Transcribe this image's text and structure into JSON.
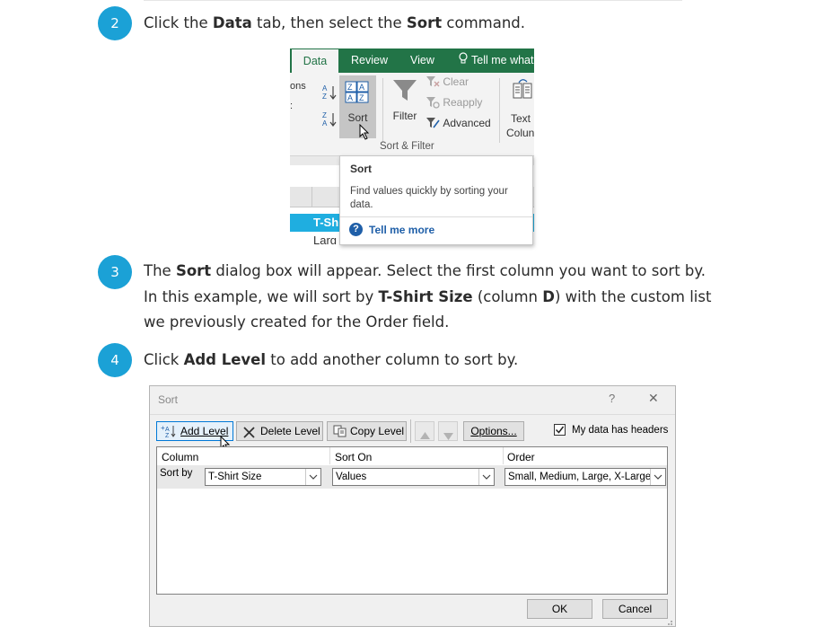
{
  "steps": [
    {
      "number": "2",
      "parts": [
        "Click the ",
        "Data",
        " tab, then select the ",
        "Sort",
        " command."
      ]
    },
    {
      "number": "3",
      "lines": [
        [
          "The ",
          "Sort",
          " dialog box will appear. Select the first column you want to sort by."
        ],
        [
          "In this example, we will sort by ",
          "T-Shirt Size",
          " (column ",
          "D",
          ") with the custom list"
        ],
        [
          "we previously created for the Order field."
        ]
      ]
    },
    {
      "number": "4",
      "parts": [
        "Click ",
        "Add Level",
        " to add another column to sort by."
      ]
    }
  ],
  "ribbon": {
    "tabs": [
      "Data",
      "Review",
      "View",
      "Tell me what"
    ],
    "partial_left_label": "ons",
    "sort_label": "Sort",
    "filter_label": "Filter",
    "clear_label": "Clear",
    "reapply_label": "Reapply",
    "advanced_label": "Advanced",
    "text_label": "Text",
    "column_label_partial": "Colun",
    "group_label": "Sort & Filter",
    "cell_header_partial": "T-Sh",
    "cell_row_partial": "Larg"
  },
  "tooltip": {
    "title": "Sort",
    "description": "Find values quickly by sorting your data.",
    "tell_me_more": "Tell me more"
  },
  "dialog": {
    "title": "Sort",
    "help_icon": "?",
    "close_icon": "✕",
    "add_level": "Add Level",
    "delete_level": "Delete Level",
    "copy_level": "Copy Level",
    "options": "Options...",
    "headers_checkbox_label": "My data has headers",
    "headers_checked": true,
    "columns": {
      "column": "Column",
      "sort_on": "Sort On",
      "order": "Order"
    },
    "row": {
      "label": "Sort by",
      "column_value": "T-Shirt Size",
      "sort_on_value": "Values",
      "order_value": "Small, Medium, Large, X-Large"
    },
    "ok": "OK",
    "cancel": "Cancel"
  },
  "colors": {
    "badge": "#1ba1d6",
    "excel_green": "#227447",
    "link": "#1f5fa8"
  }
}
